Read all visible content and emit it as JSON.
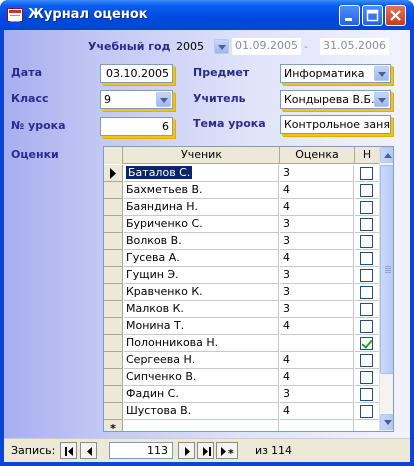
{
  "window": {
    "title": "Журнал оценок"
  },
  "header": {
    "year_label": "Учебный год",
    "year_value": "2005",
    "date_from": "01.09.2005",
    "date_sep": "-",
    "date_to": "31.05.2006"
  },
  "form": {
    "date_label": "Дата",
    "date_value": "03.10.2005",
    "class_label": "Класс",
    "class_value": "9",
    "lesson_label": "№ урока",
    "lesson_value": "6",
    "subject_label": "Предмет",
    "subject_value": "Информатика",
    "teacher_label": "Учитель",
    "teacher_value": "Кондырева В.Б.",
    "topic_label": "Тема урока",
    "topic_value": "Контрольное заня",
    "grades_label": "Оценки"
  },
  "grid": {
    "columns": [
      "Ученик",
      "Оценка",
      "Н"
    ],
    "rows": [
      {
        "name": "Баталов С.",
        "grade": "3",
        "absent": false
      },
      {
        "name": "Бахметьев В.",
        "grade": "4",
        "absent": false
      },
      {
        "name": "Баяндина Н.",
        "grade": "4",
        "absent": false
      },
      {
        "name": "Буриченко С.",
        "grade": "3",
        "absent": false
      },
      {
        "name": "Волков В.",
        "grade": "3",
        "absent": false
      },
      {
        "name": "Гусева А.",
        "grade": "4",
        "absent": false
      },
      {
        "name": "Гущин Э.",
        "grade": "3",
        "absent": false
      },
      {
        "name": "Кравченко К.",
        "grade": "3",
        "absent": false
      },
      {
        "name": "Малков К.",
        "grade": "3",
        "absent": false
      },
      {
        "name": "Монина Т.",
        "grade": "4",
        "absent": false
      },
      {
        "name": "Полонникова Н.",
        "grade": "",
        "absent": true
      },
      {
        "name": "Сергеева Н.",
        "grade": "4",
        "absent": false
      },
      {
        "name": "Сипченко В.",
        "grade": "4",
        "absent": false
      },
      {
        "name": "Фадин С.",
        "grade": "3",
        "absent": false
      },
      {
        "name": "Шустова В.",
        "grade": "4",
        "absent": false
      }
    ],
    "new_row_marker": "*"
  },
  "navigator": {
    "label": "Запись:",
    "current": "113",
    "of_label": "из",
    "total": "114"
  }
}
